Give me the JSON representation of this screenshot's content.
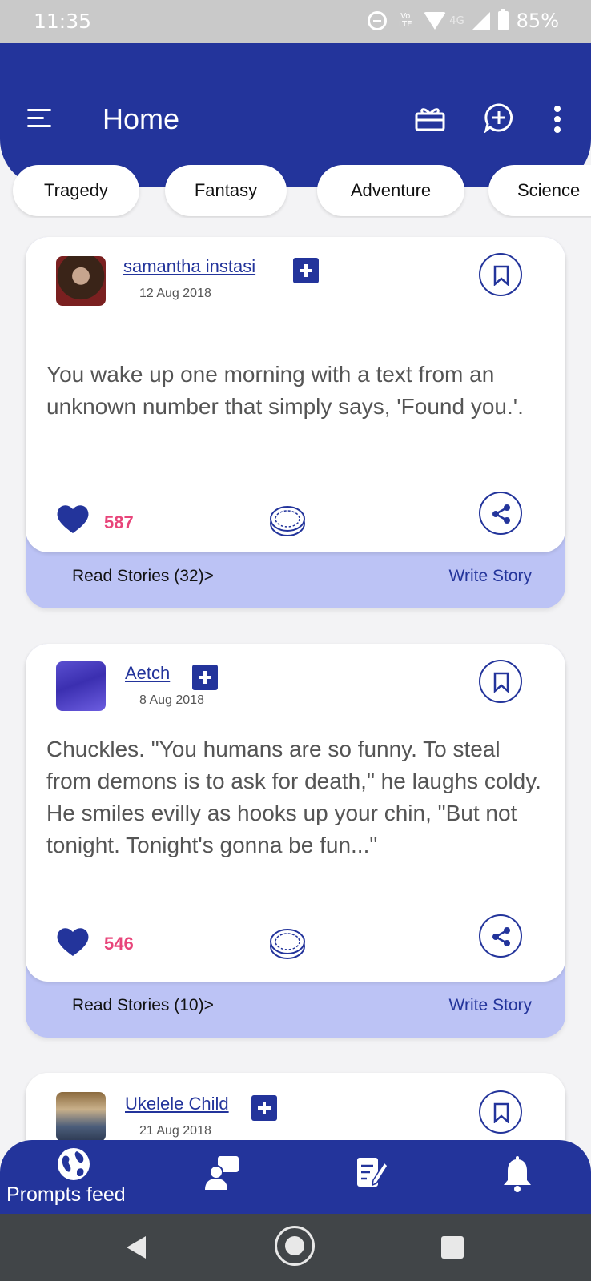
{
  "status_bar": {
    "time": "11:35",
    "lte": "Vo LTE",
    "network": "4G",
    "battery": "85%"
  },
  "app_bar": {
    "title": "Home"
  },
  "categories": [
    "Tragedy",
    "Fantasy",
    "Adventure",
    "Science"
  ],
  "posts": [
    {
      "author": "samantha instasi",
      "date": "12 Aug 2018",
      "text": "You wake up one morning with a text from an unknown number that simply says, 'Found you.'.",
      "likes": "587",
      "read_stories": "Read Stories (32)>",
      "write_story": "Write Story"
    },
    {
      "author": "Aetch",
      "date": "8 Aug 2018",
      "text": "Chuckles. \"You humans are so funny. To steal from demons is to ask for death,\" he laughs coldy. He smiles evilly as hooks up your chin, \"But not tonight. Tonight's gonna be fun...\"",
      "likes": "546",
      "read_stories": "Read Stories (10)>",
      "write_story": "Write Story"
    },
    {
      "author": "Ukelele Child",
      "date": "21 Aug 2018"
    }
  ],
  "bottom_nav": {
    "active_label": "Prompts feed"
  },
  "colors": {
    "primary": "#23349b",
    "accent_pink": "#e8457a",
    "card_footer": "#bcc3f5"
  }
}
